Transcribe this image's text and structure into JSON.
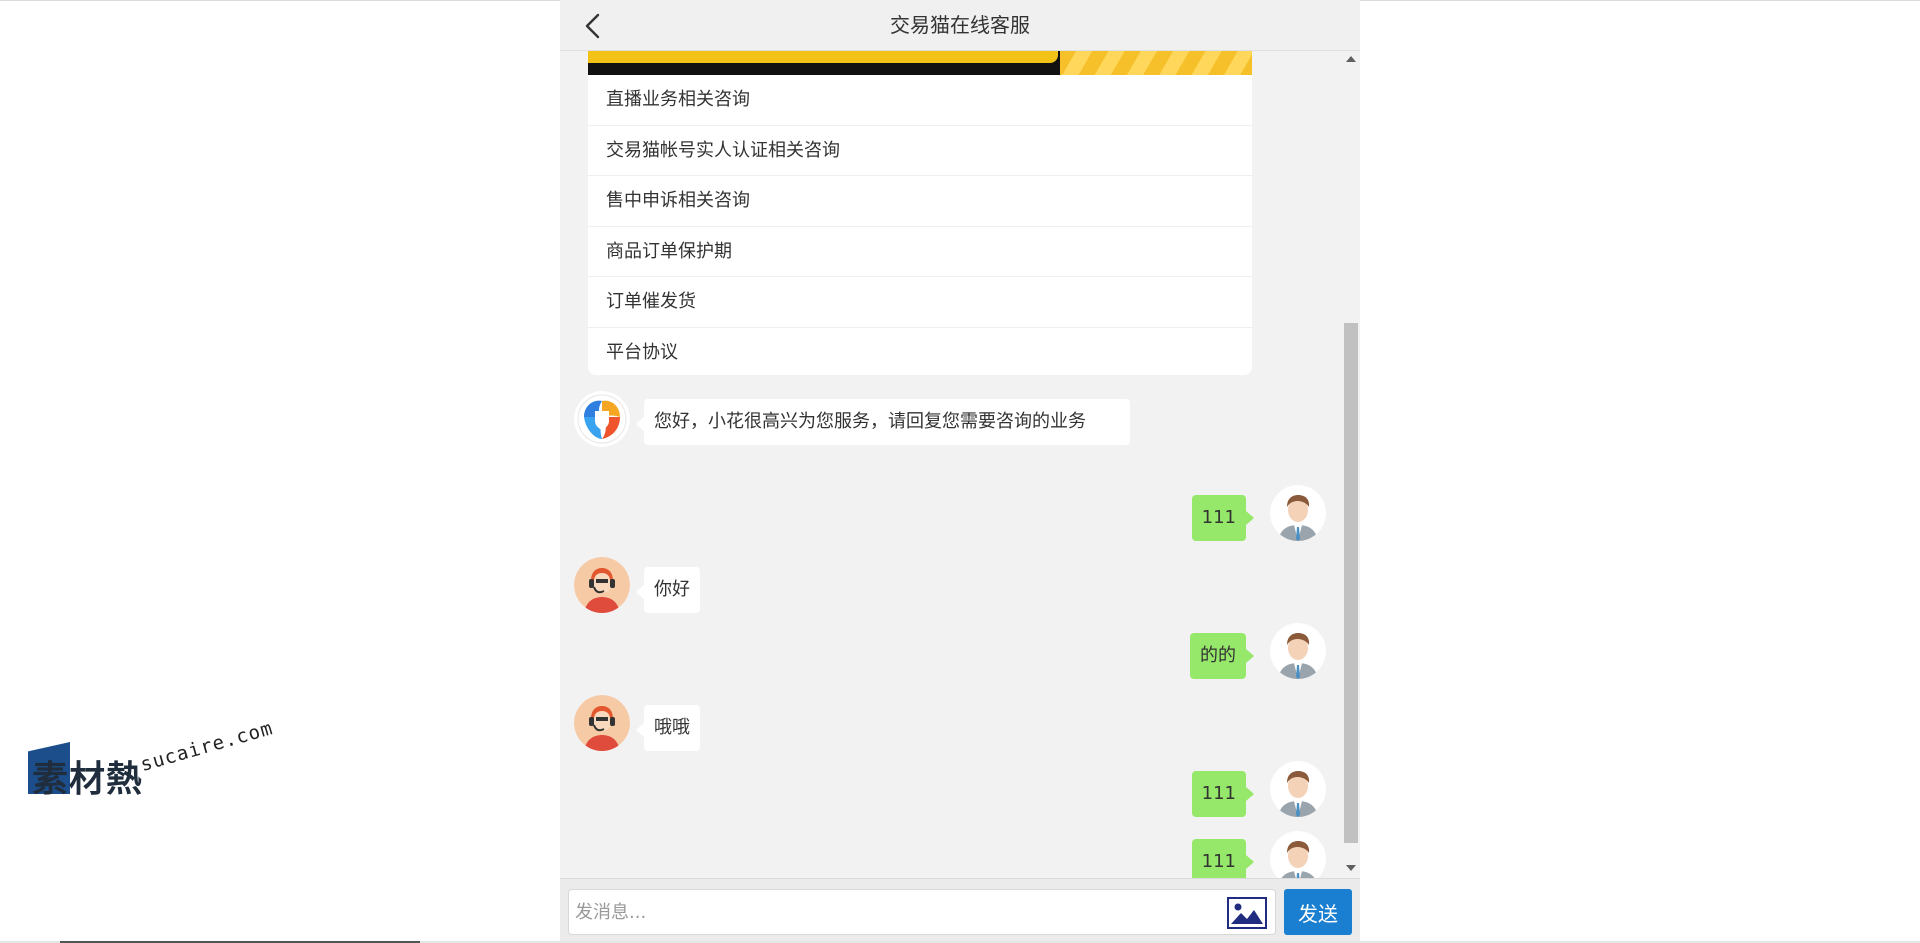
{
  "header": {
    "title": "交易猫在线客服",
    "back_icon": "chevron-left-icon"
  },
  "faq": {
    "items": [
      "直播业务相关咨询",
      "交易猫帐号实人认证相关咨询",
      "售中申诉相关咨询",
      "商品订单保护期",
      "订单催发货",
      "平台协议"
    ]
  },
  "messages": [
    {
      "side": "left",
      "avatar": "bot-logo-avatar",
      "text": "您好，小花很高兴为您服务，请回复您需要咨询的业务"
    },
    {
      "side": "right",
      "avatar": "user-avatar",
      "text": "111"
    },
    {
      "side": "left",
      "avatar": "agent-avatar",
      "text": "你好"
    },
    {
      "side": "right",
      "avatar": "user-avatar",
      "text": "的的"
    },
    {
      "side": "left",
      "avatar": "agent-avatar",
      "text": "哦哦"
    },
    {
      "side": "right",
      "avatar": "user-avatar",
      "text": "111"
    },
    {
      "side": "right",
      "avatar": "user-avatar",
      "text": "111"
    }
  ],
  "input": {
    "placeholder": "发消息...",
    "value": "",
    "image_icon": "image-icon",
    "send_label": "发送"
  },
  "watermark": {
    "brand": "素材熱",
    "domain": "sucaire.com"
  },
  "colors": {
    "header_bg": "#f0f0f0",
    "chat_bg": "#f2f2f2",
    "user_bubble": "#96e86a",
    "agent_bubble": "#ffffff",
    "send_button": "#1a7fd0"
  }
}
